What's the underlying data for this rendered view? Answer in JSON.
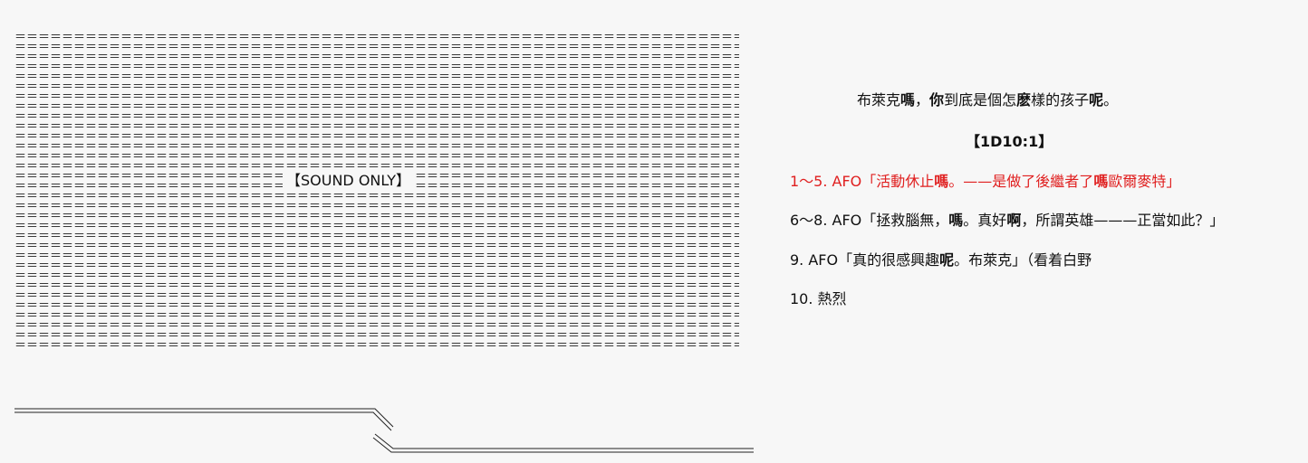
{
  "aa": {
    "row_pattern": "＝＝＝＝＝＝＝＝＝＝＝＝＝＝＝＝＝＝＝＝＝＝＝＝＝＝＝＝＝＝＝＝＝＝＝＝＝＝＝＝＝＝＝＝＝＝＝＝＝＝＝＝＝＝＝＝＝＝＝＝＝＝＝＝＝＝＝＝＝＝＝＝＝＝＝＝＝＝＝＝",
    "row_count": 32,
    "sound_label": "【SOUND ONLY】"
  },
  "dialogue": {
    "intro": [
      {
        "text": "布萊克",
        "bold": false
      },
      {
        "text": "嗎",
        "bold": true
      },
      {
        "text": "，",
        "bold": false
      },
      {
        "text": "你",
        "bold": true
      },
      {
        "text": "到底是個怎",
        "bold": false
      },
      {
        "text": "麽",
        "bold": true
      },
      {
        "text": "樣的孩子",
        "bold": false
      },
      {
        "text": "呢",
        "bold": true
      },
      {
        "text": "。",
        "bold": false
      }
    ],
    "roll": "【1D10:1】",
    "options": [
      {
        "color": "#e02020",
        "segments": [
          {
            "text": "1～5. AFO「活動休止",
            "bold": false
          },
          {
            "text": "嗎",
            "bold": true
          },
          {
            "text": "。——是做了後繼者了",
            "bold": false
          },
          {
            "text": "嗎",
            "bold": true
          },
          {
            "text": "歐爾麥特」",
            "bold": false
          }
        ]
      },
      {
        "color": "#111111",
        "segments": [
          {
            "text": "6～8. AFO「拯救腦無，",
            "bold": false
          },
          {
            "text": "嗎",
            "bold": true
          },
          {
            "text": "。真好",
            "bold": false
          },
          {
            "text": "啊",
            "bold": true
          },
          {
            "text": "，所謂英雄———正當如此？」",
            "bold": false
          }
        ]
      },
      {
        "color": "#111111",
        "segments": [
          {
            "text": "9. AFO「真的很感興趣",
            "bold": false
          },
          {
            "text": "呢",
            "bold": true
          },
          {
            "text": "。布萊克」（看着白野",
            "bold": false
          }
        ]
      },
      {
        "color": "#111111",
        "segments": [
          {
            "text": "10. 熱烈",
            "bold": false
          }
        ]
      }
    ]
  }
}
